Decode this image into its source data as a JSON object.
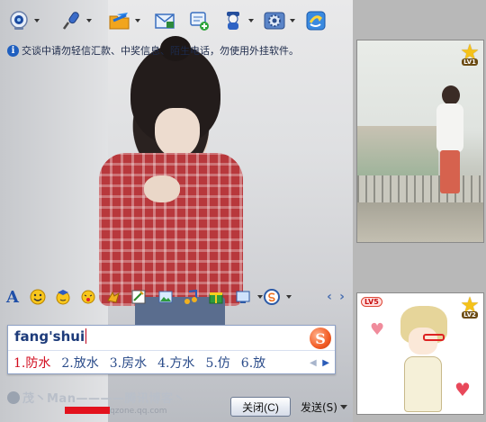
{
  "toolbar": {
    "items": [
      {
        "name": "video-call",
        "icon": "webcam-icon",
        "has_dropdown": true
      },
      {
        "name": "voice-call",
        "icon": "microphone-icon",
        "has_dropdown": true
      },
      {
        "name": "send-file",
        "icon": "folder-send-icon",
        "has_dropdown": true
      },
      {
        "name": "send-sms",
        "icon": "envelope-icon",
        "has_dropdown": false
      },
      {
        "name": "create-discussion",
        "icon": "add-group-icon",
        "has_dropdown": false
      },
      {
        "name": "qq-show",
        "icon": "penguin-user-icon",
        "has_dropdown": true
      },
      {
        "name": "apps",
        "icon": "gear-apps-icon",
        "has_dropdown": true
      },
      {
        "name": "remote-assist",
        "icon": "remote-icon",
        "has_dropdown": false
      }
    ]
  },
  "notice": {
    "text": "交谈中请勿轻信汇款、中奖信息、陌生电话，勿使用外挂软件。"
  },
  "photo_panel": {
    "level_tag": "LV1"
  },
  "avatar_panel": {
    "level_tag": "LV2",
    "badge": "LV5"
  },
  "emoticon_bar": {
    "font_label": "A",
    "prev_label": "‹",
    "next_label": "›"
  },
  "ime": {
    "input": "fang'shui",
    "logo_letter": "S",
    "candidates": [
      {
        "index": "1.",
        "text": "防水"
      },
      {
        "index": "2.",
        "text": "放水"
      },
      {
        "index": "3.",
        "text": "房水"
      },
      {
        "index": "4.",
        "text": "方水"
      },
      {
        "index": "5.",
        "text": "仿"
      },
      {
        "index": "6.",
        "text": "放"
      }
    ],
    "pager_prev": "◀",
    "pager_next": "▶"
  },
  "qzone": {
    "name": "茂丶Man————腾讯博客丶",
    "url_suffix": "qzone.qq.com"
  },
  "buttons": {
    "close_label": "关闭(C)",
    "send_label": "发送(S)"
  },
  "colors": {
    "ime_highlight": "#d20c1e",
    "ime_text": "#2b4c8a",
    "redaction": "#e3121d"
  }
}
